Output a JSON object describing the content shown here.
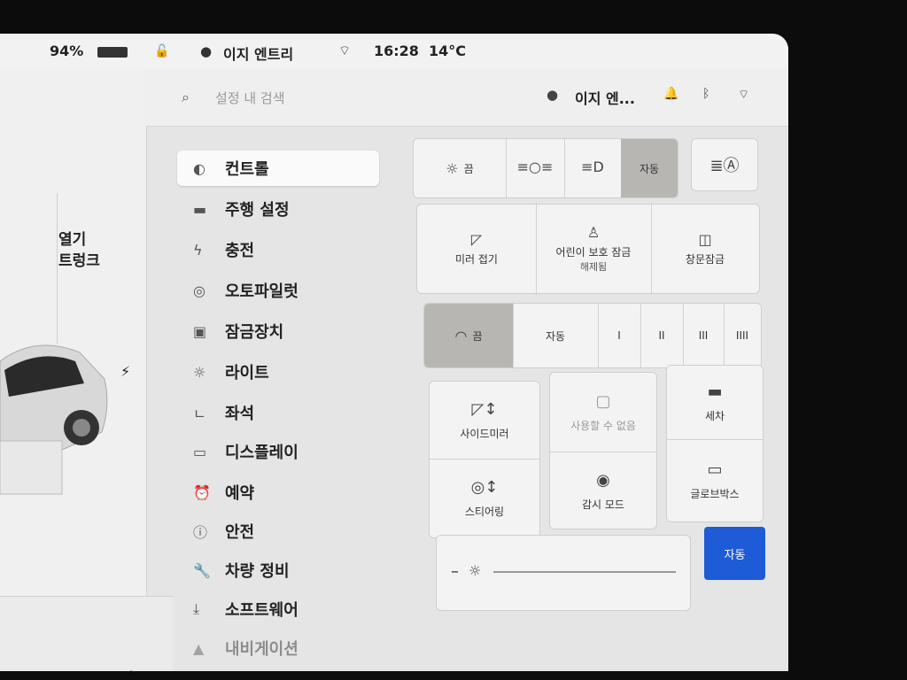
{
  "status_bar": {
    "battery": "94%",
    "profile_name": "이지 엔트리",
    "time": "16:28",
    "temperature": "14°C"
  },
  "top_bar": {
    "search_placeholder": "설정 내 검색",
    "profile_name": "이지 엔..."
  },
  "car_panel": {
    "open_label": "열기",
    "trunk_label": "트렁크"
  },
  "menu": {
    "items": [
      {
        "label": "컨트롤",
        "icon": "toggle-icon"
      },
      {
        "label": "주행 설정",
        "icon": "car-icon"
      },
      {
        "label": "충전",
        "icon": "bolt-icon"
      },
      {
        "label": "오토파일럿",
        "icon": "steering-wheel-icon"
      },
      {
        "label": "잠금장치",
        "icon": "lock-icon"
      },
      {
        "label": "라이트",
        "icon": "sun-icon"
      },
      {
        "label": "좌석",
        "icon": "seat-icon"
      },
      {
        "label": "디스플레이",
        "icon": "display-icon"
      },
      {
        "label": "예약",
        "icon": "alarm-icon"
      },
      {
        "label": "안전",
        "icon": "info-icon"
      },
      {
        "label": "차량 정비",
        "icon": "wrench-icon"
      },
      {
        "label": "소프트웨어",
        "icon": "download-icon"
      },
      {
        "label": "내비게이션",
        "icon": "navigation-icon"
      }
    ]
  },
  "lights": {
    "off_label": "끔",
    "auto_label": "자동"
  },
  "row2": {
    "mirror_fold": "미러 접기",
    "child_lock": "어린이 보호 잠금",
    "child_lock_sub": "해제됨",
    "window_lock": "창문잠금"
  },
  "wipers": {
    "off_label": "끔",
    "auto_label": "자동",
    "levels": [
      "I",
      "II",
      "III",
      "IIII"
    ]
  },
  "row4": {
    "side_mirror": "사이드미러",
    "unavailable": "사용할 수 없음",
    "car_wash": "세차",
    "steering": "스티어링",
    "sentry": "감시 모드",
    "glovebox": "글로브박스"
  },
  "brightness": {
    "auto_label": "자동",
    "minus": "–"
  }
}
